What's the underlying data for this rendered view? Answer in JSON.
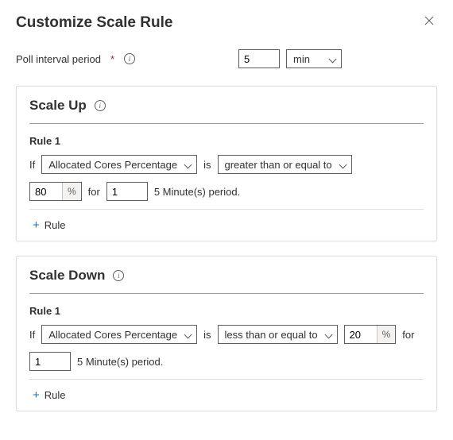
{
  "header": {
    "title": "Customize Scale Rule"
  },
  "poll": {
    "label": "Poll interval period",
    "required": "*",
    "value": "5",
    "unit": "min"
  },
  "scaleUp": {
    "title": "Scale Up",
    "rule": {
      "name": "Rule 1",
      "if": "If",
      "metric": "Allocated Cores Percentage",
      "is": "is",
      "operator": "greater than or equal to",
      "threshold": "80",
      "for": "for",
      "periods": "1",
      "suffix": "5 Minute(s) period."
    },
    "addLabel": "Rule"
  },
  "scaleDown": {
    "title": "Scale Down",
    "rule": {
      "name": "Rule 1",
      "if": "If",
      "metric": "Allocated Cores Percentage",
      "is": "is",
      "operator": "less than or equal to",
      "threshold": "20",
      "for": "for",
      "periods": "1",
      "suffix": "5 Minute(s) period."
    },
    "addLabel": "Rule"
  },
  "pctSuffix": "%"
}
